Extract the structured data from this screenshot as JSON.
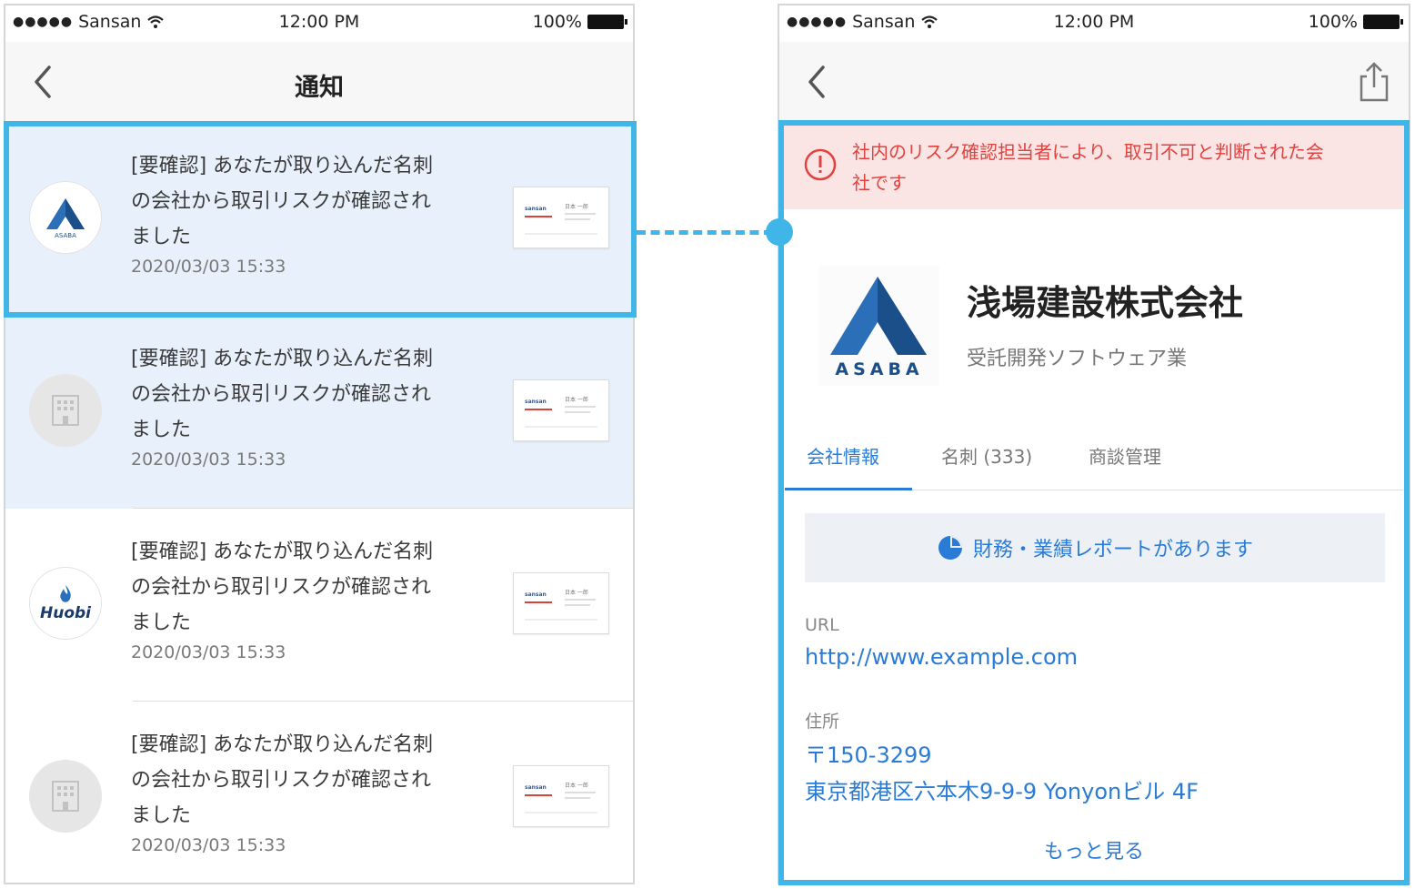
{
  "status_bar": {
    "carrier": "Sansan",
    "time": "12:00 PM",
    "battery": "100%"
  },
  "left_screen": {
    "title": "通知",
    "notifications": [
      {
        "text": "[要確認] あなたが取り込んだ名刺\nの会社から取引リスクが確認され\nました",
        "time": "2020/03/03 15:33",
        "avatar": "asaba-logo",
        "unread": true
      },
      {
        "text": "[要確認] あなたが取り込んだ名刺\nの会社から取引リスクが確認され\nました",
        "time": "2020/03/03 15:33",
        "avatar": "building-icon",
        "unread": true
      },
      {
        "text": "[要確認] あなたが取り込んだ名刺\nの会社から取引リスクが確認され\nました",
        "time": "2020/03/03 15:33",
        "avatar": "huobi-logo",
        "avatar_label": "Huobi",
        "unread": false
      },
      {
        "text": "[要確認] あなたが取り込んだ名刺\nの会社から取引リスクが確認され\nました",
        "time": "2020/03/03 15:33",
        "avatar": "building-icon",
        "unread": false
      }
    ],
    "card_thumb": {
      "brand": "sansan",
      "name": "日本 一郎"
    }
  },
  "right_screen": {
    "alert": "社内のリスク確認担当者により、取引不可と判断された会社です",
    "company": {
      "logo_text": "ASABA",
      "name": "浅場建設株式会社",
      "industry": "受託開発ソフトウェア業"
    },
    "tabs": [
      {
        "label": "会社情報",
        "active": true
      },
      {
        "label": "名刺 (333)",
        "active": false
      },
      {
        "label": "商談管理",
        "active": false
      }
    ],
    "report_banner": "財務・業績レポートがあります",
    "url_label": "URL",
    "url": "http://www.example.com",
    "address_label": "住所",
    "postal_code": "〒150-3299",
    "address": "東京都港区六本木9-9-9 Yonyonビル 4F",
    "more_link": "もっと見る"
  },
  "colors": {
    "highlight": "#3fb5e8",
    "link": "#2a7bd6",
    "alert_bg": "#fbe4e4",
    "alert_text": "#e2423e",
    "unread_bg": "#e8f1fb"
  }
}
